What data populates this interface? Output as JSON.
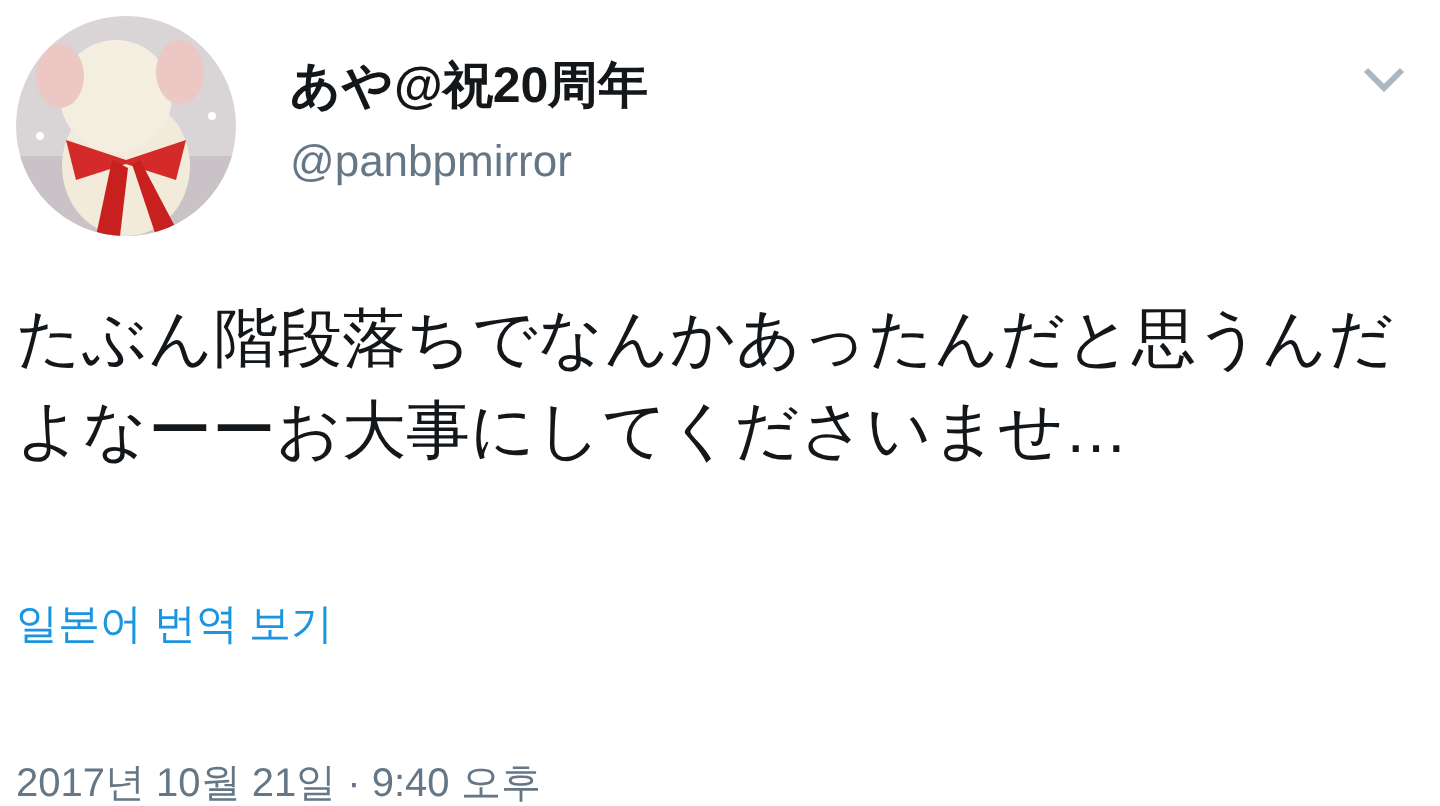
{
  "tweet": {
    "author": {
      "name": "あや@祝20周年",
      "handle": "@panbpmirror"
    },
    "text": "たぶん階段落ちでなんかあったんだと思うんだよなーーお大事にしてくださいませ…",
    "translate_link": "일본어 번역 보기",
    "timestamp": "2017년 10월 21일 · 9:40 오후"
  }
}
